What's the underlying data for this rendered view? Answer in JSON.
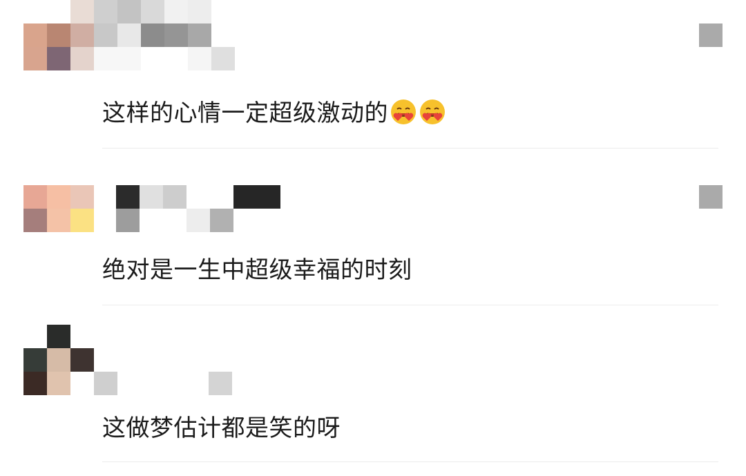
{
  "comments": [
    {
      "text": "这样的心情一定超级激动的",
      "emojis": [
        "smiling-face-with-hearts-hugging",
        "smiling-face-with-hearts-hugging"
      ],
      "avatar_colors": [
        "#d9a48c",
        "#b98672",
        "#d0aea3",
        "#7e6674",
        "#e4d3cc"
      ],
      "name_colors": [
        "#d7d7d7",
        "#c6c6c6",
        "#dcdcdc",
        "#e7e7e7",
        "#8f8f8f",
        "#a5a5a5"
      ]
    },
    {
      "text": "绝对是一生中超级幸福的时刻",
      "avatar_colors": [
        "#e7a795",
        "#f6bfa4",
        "#eac6b7",
        "#a57e7c",
        "#f4c2a7",
        "#fbe183"
      ],
      "name_colors": [
        "#2b2b2b",
        "#e0e0e0",
        "#cdcdcd",
        "#262626",
        "#9d9d9d",
        "#ededed",
        "#b1b1b1"
      ]
    },
    {
      "text": "这做梦估计都是笑的呀",
      "avatar_colors": [
        "#2a2c2a",
        "#363c38",
        "#d6bba7",
        "#3e3330",
        "#3b2a25",
        "#e0c3ae"
      ],
      "name_colors": [
        "#cfcfcf",
        "#d4d4d4"
      ]
    }
  ]
}
